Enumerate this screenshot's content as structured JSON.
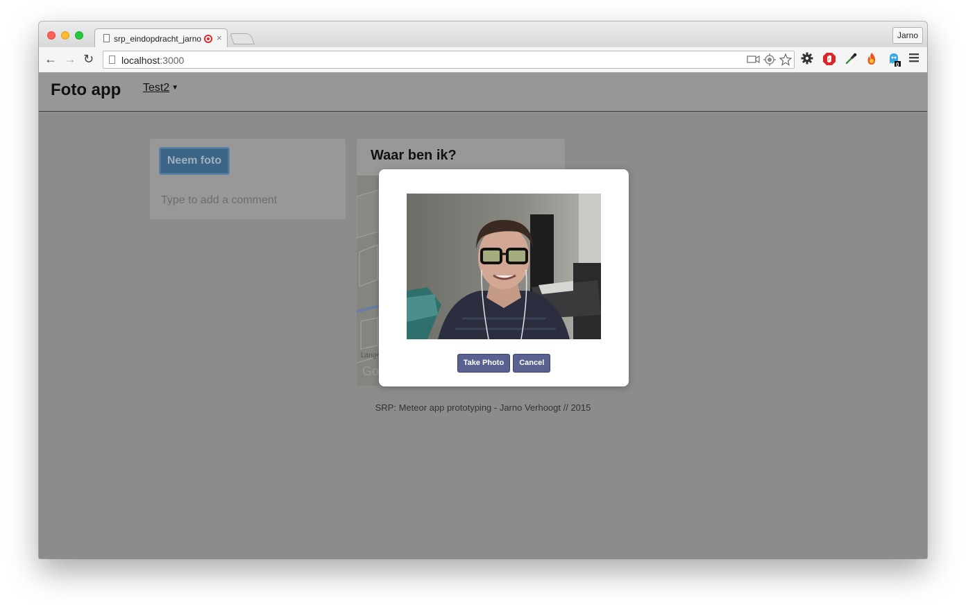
{
  "browser": {
    "tab_title": "srp_eindopdracht_jarno",
    "tab_close": "×",
    "profile_name": "Jarno",
    "url_host": "localhost",
    "url_port": ":3000",
    "nav": {
      "back": "←",
      "forward": "→",
      "reload": "↻"
    },
    "extension_badge": "0"
  },
  "app": {
    "brand": "Foto app",
    "user_menu": "Test2",
    "caret": "▼"
  },
  "left_card": {
    "take_photo_button": "Neem foto",
    "comment_placeholder": "Type to add a comment"
  },
  "right_card": {
    "title": "Waar ben ik?",
    "map_labels": [
      "Lange",
      "Go"
    ]
  },
  "footer": "SRP: Meteor app prototyping - Jarno Verhoogt // 2015",
  "modal": {
    "take_photo": "Take Photo",
    "cancel": "Cancel"
  }
}
